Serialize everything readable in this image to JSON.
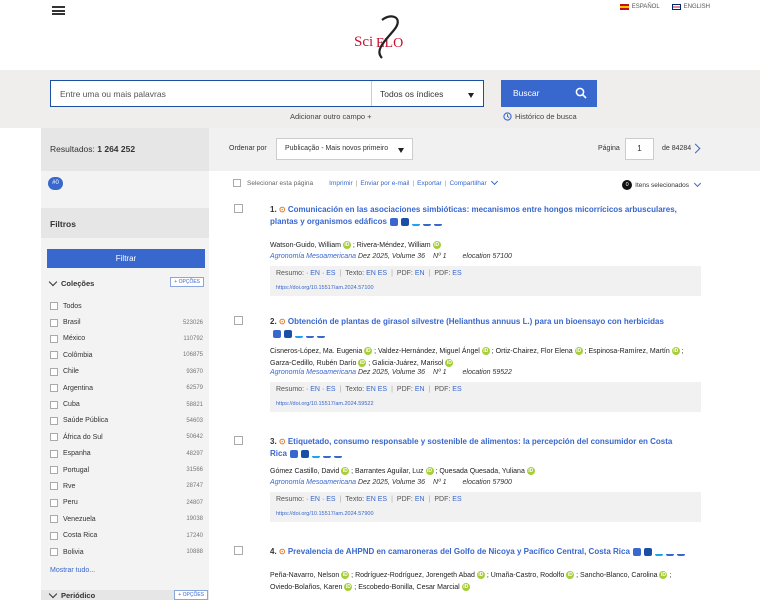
{
  "header": {
    "logo_text": "SciELO",
    "languages": [
      {
        "label": "ESPAÑOL"
      },
      {
        "label": "ENGLISH"
      }
    ]
  },
  "search": {
    "placeholder": "Entre uma ou mais palavras",
    "index_selected": "Todos os índices",
    "button_label": "Buscar",
    "add_field_label": "Adicionar outro campo +",
    "history_label": "Histórico de busca"
  },
  "sidebar": {
    "results_label": "Resultados:",
    "results_count": "1 264 252",
    "tag": "#0",
    "filters_title": "Filtros",
    "filter_button": "Filtrar",
    "collections_title": "Coleções",
    "options_label": "+ OPÇÕES",
    "collections": [
      {
        "name": "Todos",
        "count": ""
      },
      {
        "name": "Brasil",
        "count": "523026"
      },
      {
        "name": "México",
        "count": "110792"
      },
      {
        "name": "Colômbia",
        "count": "106875"
      },
      {
        "name": "Chile",
        "count": "93670"
      },
      {
        "name": "Argentina",
        "count": "62579"
      },
      {
        "name": "Cuba",
        "count": "58821"
      },
      {
        "name": "Saúde Pública",
        "count": "54603"
      },
      {
        "name": "África do Sul",
        "count": "50642"
      },
      {
        "name": "Espanha",
        "count": "48297"
      },
      {
        "name": "Portugal",
        "count": "31566"
      },
      {
        "name": "Rve",
        "count": "28747"
      },
      {
        "name": "Peru",
        "count": "24807"
      },
      {
        "name": "Venezuela",
        "count": "19038"
      },
      {
        "name": "Costa Rica",
        "count": "17240"
      },
      {
        "name": "Bolivia",
        "count": "10888"
      }
    ],
    "show_all": "Mostrar tudo...",
    "periodicos_title": "Periódico",
    "periodicos_options": "+ OPÇÕES"
  },
  "toolbar": {
    "order_label": "Ordenar por",
    "order_selected": "Publicação - Mais novos primeiro",
    "page_label": "Página",
    "page_value": "1",
    "page_of": "de 84284"
  },
  "actions": {
    "select_page": "Selecionar esta página",
    "print": "Imprimir",
    "email": "Enviar por e-mail",
    "export": "Exportar",
    "share": "Compartilhar",
    "selected_count": "0",
    "selected_label": "Itens selecionados"
  },
  "results": [
    {
      "num": "1.",
      "title": "Comunicación en las asociaciones simbióticas: mecanismos entre hongos micorrícicos arbusculares, plantas y organismos edáficos",
      "authors": [
        "Watson-Guido, William",
        "Rivera-Méndez, William"
      ],
      "journal": "Agronomía Mesoamericana",
      "date": "Dez 2025,",
      "volume": "Volume 36",
      "issue": "Nº 1",
      "elocation": "elocation",
      "eloc_num": "57100",
      "doi": "https://doi.org/10.15517/am.2024.57100"
    },
    {
      "num": "2.",
      "title": "Obtención de plantas de girasol silvestre (Helianthus annuus L.) para un bioensayo con herbicidas",
      "authors": [
        "Cisneros-López, Ma. Eugenia",
        "Valdez-Hernández, Miguel Ángel",
        "Ortiz-Chairez, Flor Elena",
        "Espinosa-Ramírez, Martín",
        "Garza-Cedillo, Rubén Darío",
        "Galicia-Juárez, Marisol"
      ],
      "journal": "Agronomía Mesoamericana",
      "date": "Dez 2025,",
      "volume": "Volume 36",
      "issue": "Nº 1",
      "elocation": "elocation",
      "eloc_num": "59522",
      "doi": "https://doi.org/10.15517/am.2024.59522"
    },
    {
      "num": "3.",
      "title": "Etiquetado, consumo responsable y sostenible de alimentos: la percepción del consumidor en Costa Rica",
      "authors": [
        "Gómez Castillo, David",
        "Barrantes Aguilar, Luz",
        "Quesada Quesada, Yuliana"
      ],
      "journal": "Agronomía Mesoamericana",
      "date": "Dez 2025,",
      "volume": "Volume 36",
      "issue": "Nº 1",
      "elocation": "elocation",
      "eloc_num": "57900",
      "doi": "https://doi.org/10.15517/am.2024.57900"
    },
    {
      "num": "4.",
      "title": "Prevalencia de AHPND en camaroneras del Golfo de Nicoya y Pacífico Central, Costa Rica",
      "authors": [
        "Peña-Navarro, Nelson",
        "Rodríguez-Rodríguez, Jorengeth Abad",
        "Umaña-Castro, Rodolfo",
        "Sancho-Blanco, Carolina",
        "Oviedo-Bolaños, Karen",
        "Escobedo-Bonilla, Cesar Marcial"
      ]
    }
  ],
  "links": {
    "resumo": "Resumo:",
    "texto": "Texto:",
    "pdf": "PDF:",
    "en": "EN",
    "es": "ES",
    "arrow": "·"
  },
  "colors": {
    "accent": "#3867ce",
    "orcid": "#a6ce39",
    "open_access": "#e17727"
  }
}
